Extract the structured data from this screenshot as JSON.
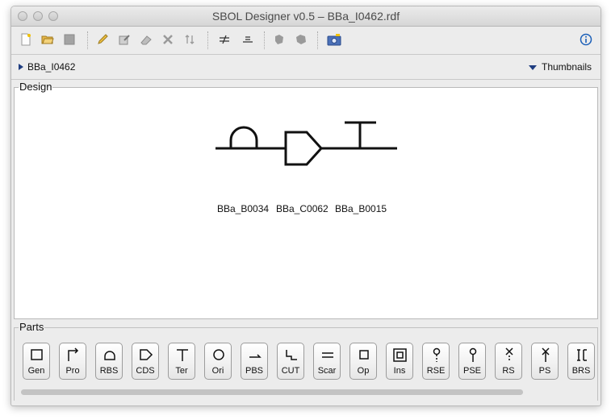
{
  "window": {
    "title": "SBOL Designer v0.5 – BBa_I0462.rdf"
  },
  "toolbar": {
    "buttons": [
      {
        "name": "new-icon",
        "glyph": "❏"
      },
      {
        "name": "open-icon",
        "glyph": "📂"
      },
      {
        "name": "save-icon",
        "glyph": "■"
      },
      {
        "name": "edit-icon",
        "glyph": "✎"
      },
      {
        "name": "edit-part-icon",
        "glyph": "✐"
      },
      {
        "name": "eraser-icon",
        "glyph": "⌫"
      },
      {
        "name": "delete-icon",
        "glyph": "✕"
      },
      {
        "name": "flip-icon",
        "glyph": "⇅"
      },
      {
        "name": "hide-scars-icon",
        "glyph": "≠"
      },
      {
        "name": "add-scars-icon",
        "glyph": "≡"
      },
      {
        "name": "focus-in-icon",
        "glyph": "◆"
      },
      {
        "name": "focus-out-icon",
        "glyph": "◆"
      },
      {
        "name": "snapshot-icon",
        "glyph": "📷"
      },
      {
        "name": "info-icon",
        "glyph": "ⓘ"
      }
    ]
  },
  "breadcrumb": {
    "label": "BBa_I0462",
    "thumbnails_label": "Thumbnails"
  },
  "design": {
    "legend": "Design",
    "parts": [
      {
        "type": "RBS",
        "label": "BBa_B0034"
      },
      {
        "type": "CDS",
        "label": "BBa_C0062"
      },
      {
        "type": "Terminator",
        "label": "BBa_B0015"
      }
    ]
  },
  "parts": {
    "legend": "Parts",
    "buttons": [
      {
        "label": "Gen",
        "icon": "gen-icon"
      },
      {
        "label": "Pro",
        "icon": "promoter-icon"
      },
      {
        "label": "RBS",
        "icon": "rbs-icon"
      },
      {
        "label": "CDS",
        "icon": "cds-icon"
      },
      {
        "label": "Ter",
        "icon": "terminator-icon"
      },
      {
        "label": "Ori",
        "icon": "origin-icon"
      },
      {
        "label": "PBS",
        "icon": "pbs-icon"
      },
      {
        "label": "CUT",
        "icon": "cut-icon"
      },
      {
        "label": "Scar",
        "icon": "scar-icon"
      },
      {
        "label": "Op",
        "icon": "operator-icon"
      },
      {
        "label": "Ins",
        "icon": "insulator-icon"
      },
      {
        "label": "RSE",
        "icon": "rse-icon"
      },
      {
        "label": "PSE",
        "icon": "pse-icon"
      },
      {
        "label": "RS",
        "icon": "rs-icon"
      },
      {
        "label": "PS",
        "icon": "ps-icon"
      },
      {
        "label": "BRS",
        "icon": "brs-icon"
      }
    ]
  },
  "colors": {
    "accent": "#1f3d80",
    "info": "#1b5fb8"
  }
}
